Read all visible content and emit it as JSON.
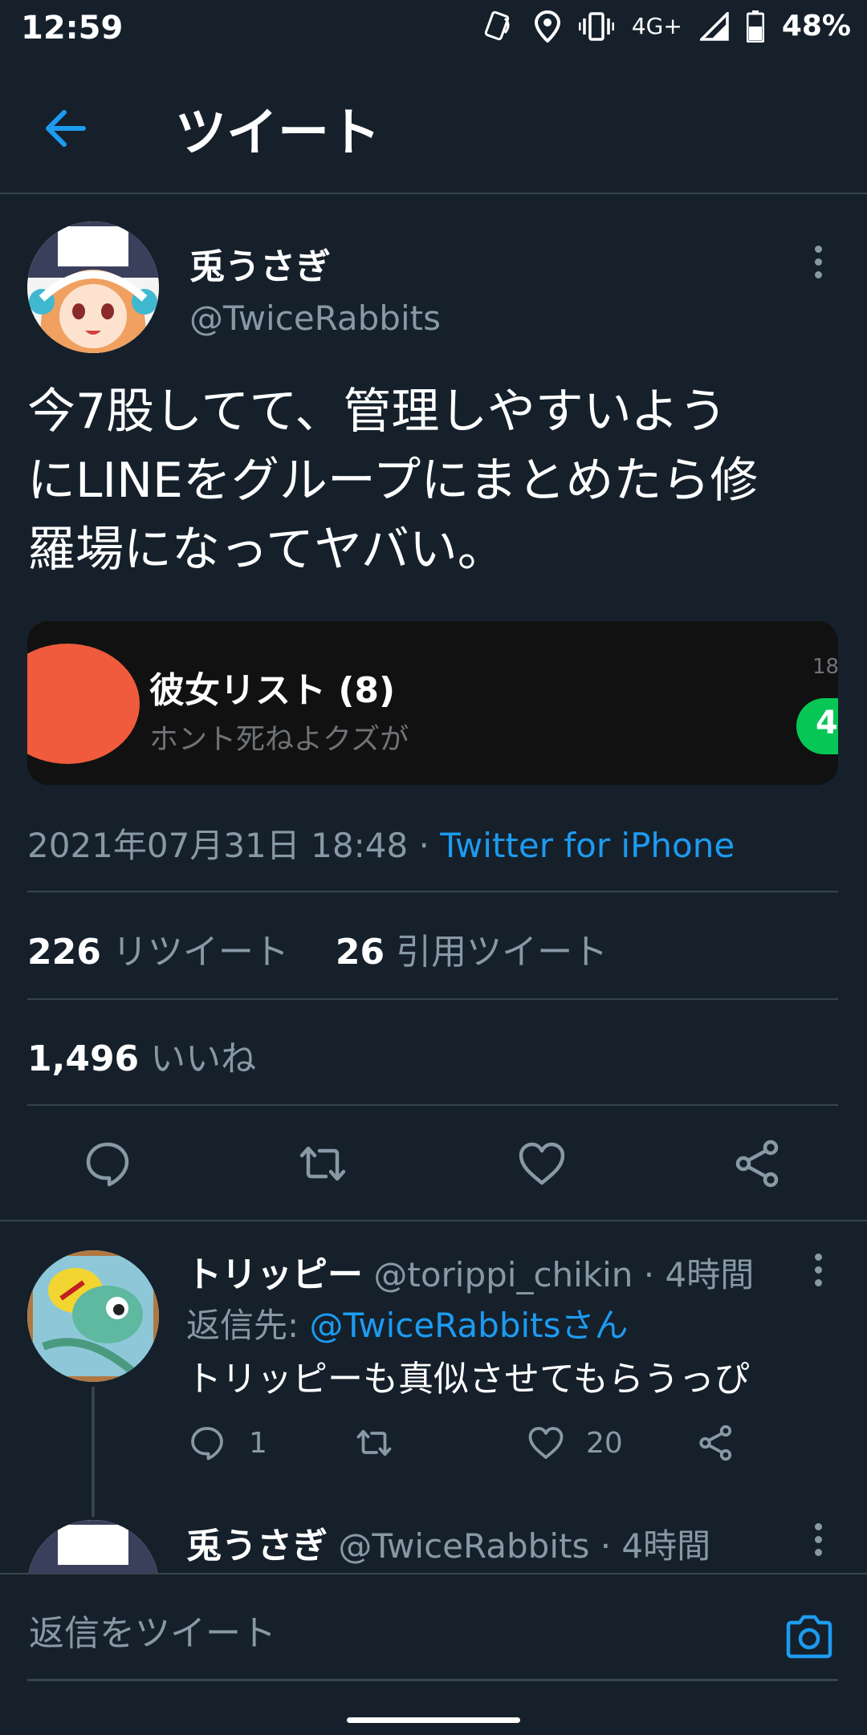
{
  "status_bar": {
    "time": "12:59",
    "network": "4G+",
    "battery": "48%",
    "icons": [
      "nfc-icon",
      "location-icon",
      "vibrate-icon",
      "signal-icon",
      "battery-icon"
    ]
  },
  "header": {
    "title": "ツイート"
  },
  "tweet": {
    "author_name": "兎うさぎ",
    "author_handle": "@TwiceRabbits",
    "text_lines": [
      "今7股してて、管理しやすいよう",
      "にLINEをグループにまとめたら修",
      "羅場になってヤバい。"
    ],
    "media": {
      "title": "彼女リスト (8)",
      "subtitle": "ホント死ねよクズが",
      "time": "18",
      "badge": "4"
    },
    "timestamp": "2021年07月31日 18:48 · ",
    "source": "Twitter for iPhone",
    "retweets": "226",
    "retweets_label": " リツイート",
    "quotes": "26",
    "quotes_label": " 引用ツイート",
    "likes": "1,496",
    "likes_label": " いいね"
  },
  "replies": [
    {
      "name": "トリッピー",
      "handle": " @torippi_chikin · 4時間",
      "reply_to_label": "返信先: ",
      "reply_to_mention": "@TwiceRabbitsさん",
      "text": "トリッピーも真似させてもらうっぴ",
      "reply_count": "1",
      "like_count": "20"
    },
    {
      "name": "兎うさぎ",
      "handle": " @TwiceRabbits · 4時間"
    }
  ],
  "compose": {
    "placeholder": "返信をツイート"
  },
  "colors": {
    "background": "#15202b",
    "accent": "#1d9bf0",
    "muted": "#8899a6",
    "divider": "#38444d"
  }
}
